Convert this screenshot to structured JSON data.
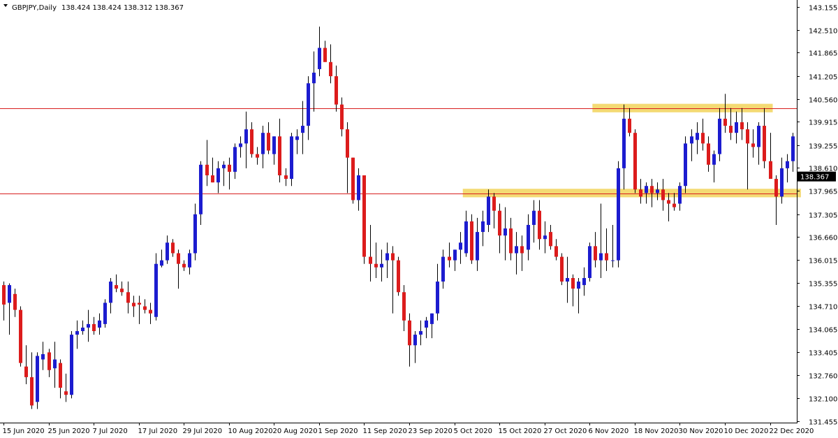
{
  "header": {
    "symbol_timeframe": "GBPJPY,Daily",
    "ohlc": "138.424 138.424 138.312 138.367"
  },
  "last_price_label": "138.367",
  "colors": {
    "background": "#ffffff",
    "axis": "#000000",
    "bull": "#1c1ccf",
    "bear": "#dc1c1c",
    "wick": "#000000",
    "level_line": "#d81e1e",
    "zone": "#f2d35a",
    "price_tag_bg": "#000000"
  },
  "chart_data": {
    "type": "candlestick",
    "title": "GBPJPY,Daily",
    "ylim": [
      131.2,
      143.3
    ],
    "y_ticks": [
      143.155,
      142.51,
      141.865,
      141.205,
      140.56,
      139.915,
      139.255,
      138.61,
      137.965,
      137.305,
      136.66,
      136.015,
      135.355,
      134.71,
      134.065,
      133.405,
      132.76,
      132.1,
      131.455
    ],
    "x_labels": [
      "15 Jun 2020",
      "25 Jun 2020",
      "7 Jul 2020",
      "17 Jul 2020",
      "29 Jul 2020",
      "10 Aug 2020",
      "20 Aug 2020",
      "1 Sep 2020",
      "11 Sep 2020",
      "23 Sep 2020",
      "5 Oct 2020",
      "15 Oct 2020",
      "27 Oct 2020",
      "6 Nov 2020",
      "18 Nov 2020",
      "30 Nov 2020",
      "10 Dec 2020",
      "22 Dec 2020"
    ],
    "x_label_bar_index": [
      0,
      8,
      16,
      24,
      32,
      40,
      48,
      56,
      64,
      72,
      80,
      88,
      96,
      104,
      112,
      120,
      128,
      136
    ],
    "horizontal_levels": [
      140.29,
      137.89
    ],
    "zones": [
      {
        "y_low": 140.18,
        "y_high": 140.42,
        "from_bar": 105,
        "to_bar": 136
      },
      {
        "y_low": 137.78,
        "y_high": 138.02,
        "from_bar": 82,
        "to_bar": 141
      }
    ],
    "last_price": 138.367,
    "candles": [
      [
        135.3,
        135.4,
        134.3,
        134.75
      ],
      [
        134.8,
        135.35,
        133.9,
        135.3
      ],
      [
        135.05,
        135.2,
        134.4,
        134.6
      ],
      [
        134.6,
        134.7,
        133.0,
        133.1
      ],
      [
        133.0,
        133.6,
        132.5,
        132.7
      ],
      [
        132.7,
        133.4,
        131.8,
        131.9
      ],
      [
        132.0,
        133.4,
        131.8,
        133.3
      ],
      [
        133.2,
        133.7,
        132.9,
        133.35
      ],
      [
        133.4,
        133.5,
        132.7,
        132.9
      ],
      [
        132.95,
        133.7,
        132.4,
        133.2
      ],
      [
        133.1,
        133.2,
        132.1,
        132.4
      ],
      [
        132.3,
        132.8,
        132.0,
        132.2
      ],
      [
        132.2,
        134.0,
        132.1,
        133.9
      ],
      [
        133.9,
        134.3,
        133.5,
        134.0
      ],
      [
        134.0,
        134.3,
        133.9,
        134.1
      ],
      [
        134.1,
        134.6,
        133.7,
        134.2
      ],
      [
        134.2,
        134.4,
        133.9,
        134.0
      ],
      [
        134.1,
        134.5,
        133.9,
        134.3
      ],
      [
        134.2,
        134.9,
        134.1,
        134.8
      ],
      [
        134.8,
        135.5,
        134.5,
        135.4
      ],
      [
        135.3,
        135.6,
        135.1,
        135.2
      ],
      [
        135.2,
        135.4,
        135.0,
        135.1
      ],
      [
        135.1,
        135.4,
        134.5,
        134.8
      ],
      [
        134.8,
        135.0,
        134.4,
        134.7
      ],
      [
        134.8,
        135.0,
        134.2,
        134.75
      ],
      [
        134.7,
        134.9,
        134.5,
        134.6
      ],
      [
        134.6,
        134.8,
        134.2,
        134.5
      ],
      [
        134.4,
        136.2,
        134.3,
        135.9
      ],
      [
        135.85,
        136.3,
        135.8,
        136.0
      ],
      [
        136.0,
        136.7,
        135.9,
        136.5
      ],
      [
        136.5,
        136.6,
        136.1,
        136.2
      ],
      [
        136.2,
        136.3,
        135.2,
        135.9
      ],
      [
        135.9,
        136.0,
        135.7,
        135.8
      ],
      [
        135.8,
        136.3,
        135.6,
        136.2
      ],
      [
        136.2,
        137.6,
        136.0,
        137.3
      ],
      [
        137.3,
        138.8,
        137.0,
        138.7
      ],
      [
        138.7,
        139.4,
        138.1,
        138.4
      ],
      [
        138.4,
        138.9,
        138.2,
        138.2
      ],
      [
        138.2,
        138.8,
        137.9,
        138.6
      ],
      [
        138.6,
        138.8,
        138.1,
        138.7
      ],
      [
        138.7,
        138.9,
        138.0,
        138.5
      ],
      [
        138.5,
        139.3,
        138.3,
        139.2
      ],
      [
        139.2,
        139.5,
        138.9,
        139.3
      ],
      [
        139.3,
        140.2,
        138.6,
        139.7
      ],
      [
        139.7,
        139.9,
        138.9,
        139.0
      ],
      [
        139.0,
        139.2,
        138.7,
        138.9
      ],
      [
        139.0,
        139.8,
        138.6,
        139.6
      ],
      [
        139.6,
        139.9,
        139.0,
        139.1
      ],
      [
        139.0,
        139.5,
        138.7,
        139.5
      ],
      [
        139.5,
        140.0,
        138.2,
        138.4
      ],
      [
        138.4,
        138.6,
        138.1,
        138.3
      ],
      [
        138.3,
        139.6,
        138.1,
        139.5
      ],
      [
        139.4,
        139.7,
        139.0,
        139.5
      ],
      [
        139.6,
        140.5,
        139.0,
        139.8
      ],
      [
        139.8,
        141.2,
        139.4,
        141.0
      ],
      [
        141.0,
        141.9,
        140.2,
        141.3
      ],
      [
        141.4,
        142.6,
        141.2,
        142.0
      ],
      [
        142.0,
        142.2,
        141.7,
        141.6
      ],
      [
        141.6,
        142.1,
        141.0,
        141.2
      ],
      [
        141.2,
        141.5,
        140.2,
        140.4
      ],
      [
        140.4,
        140.6,
        139.5,
        139.7
      ],
      [
        139.7,
        139.9,
        137.9,
        138.9
      ],
      [
        138.9,
        138.9,
        137.6,
        137.7
      ],
      [
        137.7,
        138.6,
        137.4,
        138.4
      ],
      [
        138.4,
        138.4,
        135.9,
        136.1
      ],
      [
        136.1,
        137.0,
        135.4,
        135.9
      ],
      [
        135.9,
        136.5,
        135.5,
        135.8
      ],
      [
        135.8,
        136.3,
        135.4,
        135.9
      ],
      [
        136.0,
        136.5,
        135.5,
        136.2
      ],
      [
        136.2,
        136.4,
        134.5,
        136.0
      ],
      [
        136.0,
        136.1,
        135.0,
        135.1
      ],
      [
        135.1,
        135.3,
        134.0,
        134.3
      ],
      [
        134.3,
        134.5,
        133.0,
        133.6
      ],
      [
        133.6,
        134.0,
        133.1,
        133.9
      ],
      [
        133.9,
        134.3,
        133.6,
        134.0
      ],
      [
        134.1,
        134.4,
        133.8,
        134.3
      ],
      [
        134.2,
        134.5,
        133.8,
        134.5
      ],
      [
        134.5,
        135.9,
        134.3,
        135.4
      ],
      [
        135.4,
        136.3,
        135.2,
        136.1
      ],
      [
        136.1,
        136.5,
        135.8,
        136.0
      ],
      [
        136.0,
        136.3,
        135.7,
        136.3
      ],
      [
        136.3,
        136.8,
        135.9,
        136.5
      ],
      [
        136.2,
        137.4,
        136.1,
        137.1
      ],
      [
        137.1,
        137.3,
        135.9,
        136.0
      ],
      [
        136.0,
        137.2,
        135.7,
        136.8
      ],
      [
        136.8,
        137.4,
        136.4,
        137.1
      ],
      [
        137.0,
        138.0,
        136.8,
        137.8
      ],
      [
        137.8,
        137.9,
        136.9,
        137.4
      ],
      [
        137.4,
        137.6,
        136.2,
        136.7
      ],
      [
        136.7,
        137.5,
        136.0,
        136.9
      ],
      [
        136.9,
        137.2,
        136.0,
        136.2
      ],
      [
        136.2,
        136.8,
        135.6,
        136.4
      ],
      [
        136.4,
        136.7,
        135.7,
        136.2
      ],
      [
        136.3,
        137.3,
        136.0,
        137.0
      ],
      [
        137.0,
        137.7,
        136.5,
        137.4
      ],
      [
        137.4,
        137.7,
        136.3,
        136.6
      ],
      [
        136.6,
        137.1,
        136.2,
        136.7
      ],
      [
        136.8,
        137.0,
        136.3,
        136.4
      ],
      [
        136.4,
        136.6,
        136.0,
        136.1
      ],
      [
        136.1,
        136.2,
        135.3,
        135.4
      ],
      [
        135.4,
        136.1,
        134.8,
        135.5
      ],
      [
        135.5,
        135.6,
        134.7,
        135.2
      ],
      [
        135.2,
        135.5,
        134.5,
        135.4
      ],
      [
        135.3,
        135.8,
        135.0,
        135.5
      ],
      [
        135.5,
        136.5,
        135.4,
        136.4
      ],
      [
        136.4,
        136.8,
        135.8,
        136.0
      ],
      [
        136.0,
        137.6,
        135.5,
        136.2
      ],
      [
        136.2,
        136.9,
        135.7,
        136.0
      ],
      [
        136.0,
        137.0,
        135.8,
        136.0
      ],
      [
        136.0,
        138.8,
        135.8,
        138.6
      ],
      [
        138.6,
        140.4,
        138.0,
        140.0
      ],
      [
        140.0,
        140.3,
        139.5,
        139.6
      ],
      [
        139.6,
        139.7,
        137.9,
        138.0
      ],
      [
        138.0,
        138.3,
        137.6,
        137.8
      ],
      [
        137.9,
        138.2,
        137.6,
        138.1
      ],
      [
        138.1,
        138.3,
        137.5,
        137.9
      ],
      [
        137.9,
        138.2,
        137.7,
        138.0
      ],
      [
        138.0,
        138.3,
        137.4,
        137.7
      ],
      [
        137.7,
        137.9,
        137.1,
        137.6
      ],
      [
        137.6,
        137.9,
        137.4,
        137.5
      ],
      [
        137.6,
        138.2,
        137.4,
        138.1
      ],
      [
        138.1,
        139.5,
        137.9,
        139.3
      ],
      [
        139.3,
        139.7,
        138.8,
        139.5
      ],
      [
        139.4,
        139.9,
        139.0,
        139.6
      ],
      [
        139.6,
        140.0,
        139.1,
        139.3
      ],
      [
        139.3,
        139.5,
        138.5,
        138.7
      ],
      [
        138.7,
        139.1,
        138.2,
        139.0
      ],
      [
        139.0,
        140.3,
        138.8,
        140.0
      ],
      [
        140.0,
        140.7,
        139.6,
        139.8
      ],
      [
        139.8,
        140.3,
        139.4,
        139.6
      ],
      [
        139.6,
        140.2,
        139.3,
        139.9
      ],
      [
        139.9,
        140.3,
        139.4,
        139.7
      ],
      [
        139.7,
        139.9,
        138.0,
        139.3
      ],
      [
        139.3,
        139.7,
        138.9,
        139.2
      ],
      [
        139.2,
        139.9,
        138.7,
        139.8
      ],
      [
        139.8,
        140.3,
        138.6,
        138.8
      ],
      [
        138.8,
        139.6,
        138.5,
        138.3
      ],
      [
        138.3,
        138.4,
        137.0,
        137.8
      ],
      [
        137.8,
        138.9,
        137.6,
        138.6
      ],
      [
        138.6,
        139.0,
        138.2,
        138.8
      ],
      [
        138.8,
        139.6,
        138.5,
        139.5
      ],
      [
        139.5,
        139.9,
        139.1,
        139.8
      ],
      [
        139.8,
        140.4,
        139.3,
        140.1
      ],
      [
        140.1,
        140.3,
        139.2,
        139.4
      ],
      [
        139.4,
        139.6,
        138.6,
        139.0
      ],
      [
        139.0,
        139.2,
        136.9,
        138.6
      ],
      [
        138.7,
        139.2,
        138.0,
        139.0
      ],
      [
        139.0,
        139.1,
        138.3,
        138.35
      ],
      [
        138.42,
        138.42,
        138.31,
        138.37
      ]
    ]
  }
}
